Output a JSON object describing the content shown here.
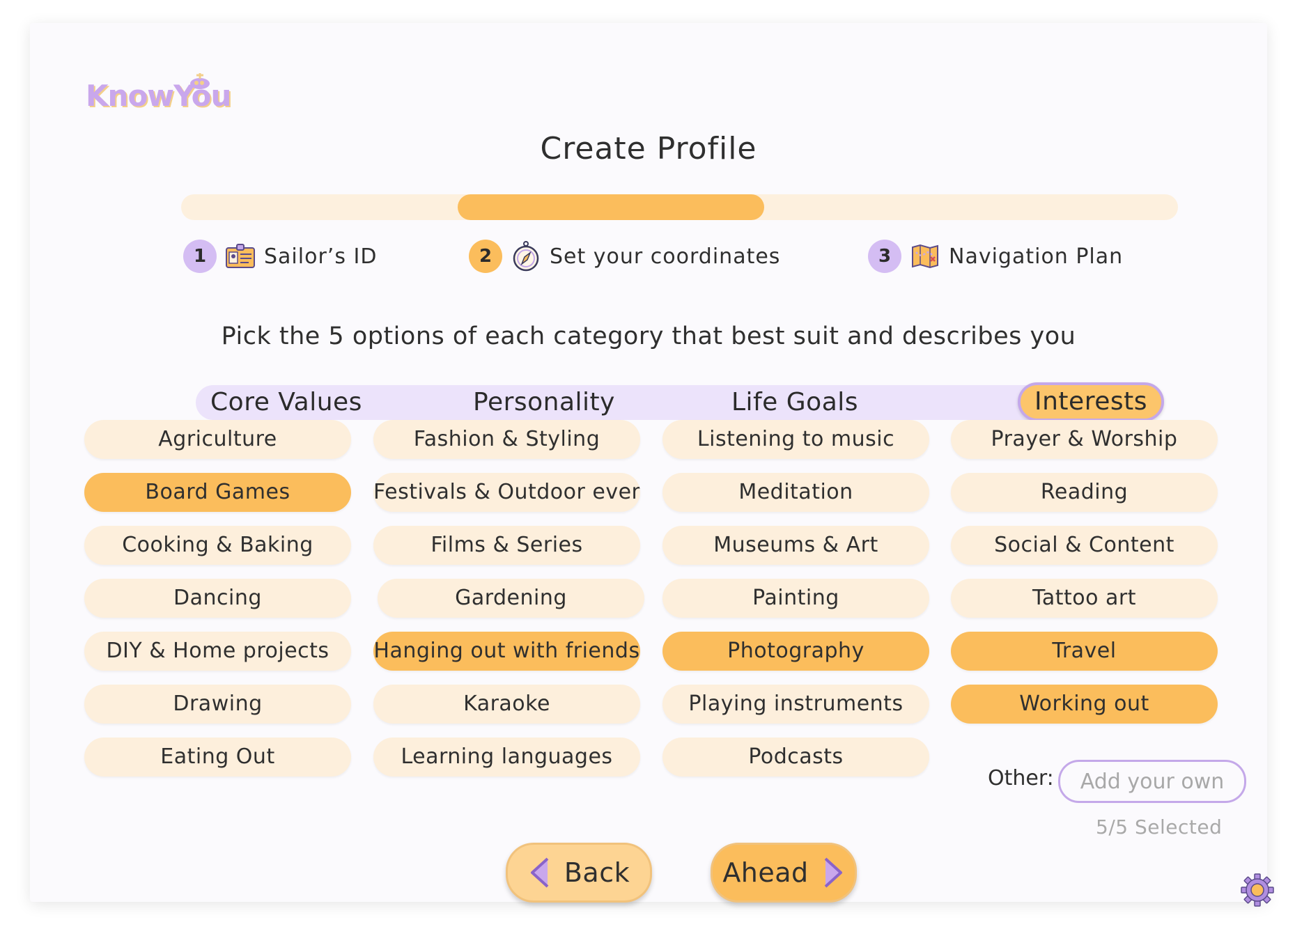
{
  "app": {
    "logo": "KnowYou"
  },
  "page_title": "Create Profile",
  "progress": {
    "current_step": 2,
    "total_steps": 3,
    "fraction": 0.6
  },
  "steps": [
    {
      "number": "1",
      "label": "Sailor’s ID",
      "icon": "id-card-icon",
      "color": "#d4bdf3"
    },
    {
      "number": "2",
      "label": "Set your coordinates",
      "icon": "compass-icon",
      "color": "#fbbd5c"
    },
    {
      "number": "3",
      "label": "Navigation Plan",
      "icon": "treasure-map-icon",
      "color": "#d4bdf3"
    }
  ],
  "instruction": "Pick the 5 options of each category that best suit and describes you",
  "tabs": [
    {
      "label": "Core Values",
      "active": false
    },
    {
      "label": "Personality",
      "active": false
    },
    {
      "label": "Life Goals",
      "active": false
    },
    {
      "label": "Interests",
      "active": true
    }
  ],
  "options": {
    "col1": [
      {
        "label": "Agriculture",
        "selected": false
      },
      {
        "label": "Board Games",
        "selected": true
      },
      {
        "label": "Cooking & Baking",
        "selected": false
      },
      {
        "label": "Dancing",
        "selected": false
      },
      {
        "label": "DIY & Home projects",
        "selected": false
      },
      {
        "label": "Drawing",
        "selected": false
      },
      {
        "label": "Eating Out",
        "selected": false
      }
    ],
    "col2": [
      {
        "label": "Fashion & Styling",
        "selected": false
      },
      {
        "label": "Festivals & Outdoor event",
        "selected": false
      },
      {
        "label": "Films & Series",
        "selected": false
      },
      {
        "label": "Gardening",
        "selected": false
      },
      {
        "label": "Hanging out with friends",
        "selected": true
      },
      {
        "label": "Karaoke",
        "selected": false
      },
      {
        "label": "Learning languages",
        "selected": false
      }
    ],
    "col3": [
      {
        "label": "Listening to music",
        "selected": false
      },
      {
        "label": "Meditation",
        "selected": false
      },
      {
        "label": "Museums & Art",
        "selected": false
      },
      {
        "label": "Painting",
        "selected": false
      },
      {
        "label": "Photography",
        "selected": true
      },
      {
        "label": "Playing instruments",
        "selected": false
      },
      {
        "label": "Podcasts",
        "selected": false
      }
    ],
    "col4": [
      {
        "label": "Prayer & Worship",
        "selected": false
      },
      {
        "label": "Reading",
        "selected": false
      },
      {
        "label": "Social & Content",
        "selected": false
      },
      {
        "label": "Tattoo art",
        "selected": false
      },
      {
        "label": "Travel",
        "selected": true
      },
      {
        "label": "Working out",
        "selected": true
      }
    ]
  },
  "other": {
    "label": "Other:",
    "placeholder": "Add your own",
    "value": ""
  },
  "selected_count": "5/5 Selected",
  "buttons": {
    "back": "Back",
    "ahead": "Ahead"
  },
  "colors": {
    "accent": "#fbbd5c",
    "chip": "#fdefdc",
    "lavender": "#c4a8e9",
    "tab_bar": "#ece3fb"
  },
  "icons": {
    "settings": "gear-icon",
    "back": "chevron-left-icon",
    "ahead": "chevron-right-icon"
  }
}
